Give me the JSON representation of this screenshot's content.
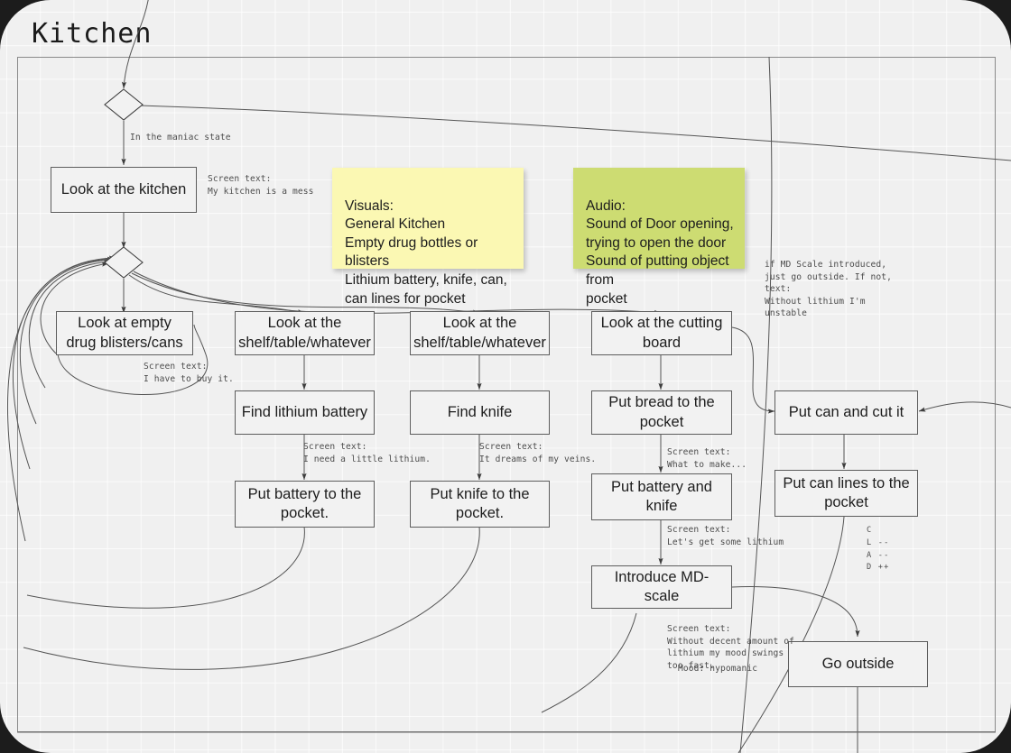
{
  "board": {
    "title": "Kitchen",
    "background_color": "#f0f0f0",
    "frame_color": "#8a8a8a"
  },
  "nodes": [
    {
      "id": "look-kitchen",
      "label": "Look at the kitchen"
    },
    {
      "id": "look-blisters",
      "label": "Look at empty drug blisters/cans"
    },
    {
      "id": "look-shelf-1",
      "label": "Look at the shelf/table/whatever"
    },
    {
      "id": "look-shelf-2",
      "label": "Look at the shelf/table/whatever"
    },
    {
      "id": "look-cutting-board",
      "label": "Look at the cutting board"
    },
    {
      "id": "find-battery",
      "label": "Find lithium battery"
    },
    {
      "id": "find-knife",
      "label": "Find knife"
    },
    {
      "id": "put-bread",
      "label": "Put bread to the pocket"
    },
    {
      "id": "put-can-cut",
      "label": "Put can and cut it"
    },
    {
      "id": "put-battery-pocket",
      "label": "Put battery to the pocket."
    },
    {
      "id": "put-knife-pocket",
      "label": "Put knife to the pocket."
    },
    {
      "id": "put-battery-knife",
      "label": "Put battery and knife"
    },
    {
      "id": "put-can-lines",
      "label": "Put can lines to the pocket"
    },
    {
      "id": "introduce-md-scale",
      "label": "Introduce MD-scale"
    },
    {
      "id": "go-outside",
      "label": "Go outside"
    }
  ],
  "notes": [
    {
      "id": "visuals-note",
      "color": "yellow",
      "text": "Visuals:\nGeneral Kitchen\nEmpty drug bottles or blisters\nLithium battery, knife, can,\ncan lines for pocket"
    },
    {
      "id": "audio-note",
      "color": "green",
      "text": "Audio:\nSound of Door opening,\ntrying to open the door\nSound of putting object from\npocket"
    }
  ],
  "annotations": [
    {
      "id": "maniac-state",
      "text": "In the maniac state"
    },
    {
      "id": "screen-text-kitchen",
      "text": "Screen text:\nMy kitchen is a mess"
    },
    {
      "id": "screen-text-buy",
      "text": "Screen text:\nI have to buy it."
    },
    {
      "id": "screen-text-lithium",
      "text": "Screen text:\nI need a little lithium."
    },
    {
      "id": "screen-text-veins",
      "text": "Screen text:\nIt dreams of my veins."
    },
    {
      "id": "screen-text-make",
      "text": "Screen text:\nWhat to make..."
    },
    {
      "id": "screen-text-getsome",
      "text": "Screen text:\nLet's get some lithium"
    },
    {
      "id": "md-scale-condition",
      "text": "if MD Scale introduced,\njust go outside. If not,\ntext:\nWithout lithium I'm\nunstable"
    },
    {
      "id": "screen-text-swings",
      "text": "Screen text:\nWithout decent amount of\nlithium my mood swings\ntoo fast."
    },
    {
      "id": "mood-hypomanic",
      "text": "Mood: hypomanic"
    },
    {
      "id": "clad-stats",
      "text": "C\nL --\nA --\nD ++"
    }
  ]
}
